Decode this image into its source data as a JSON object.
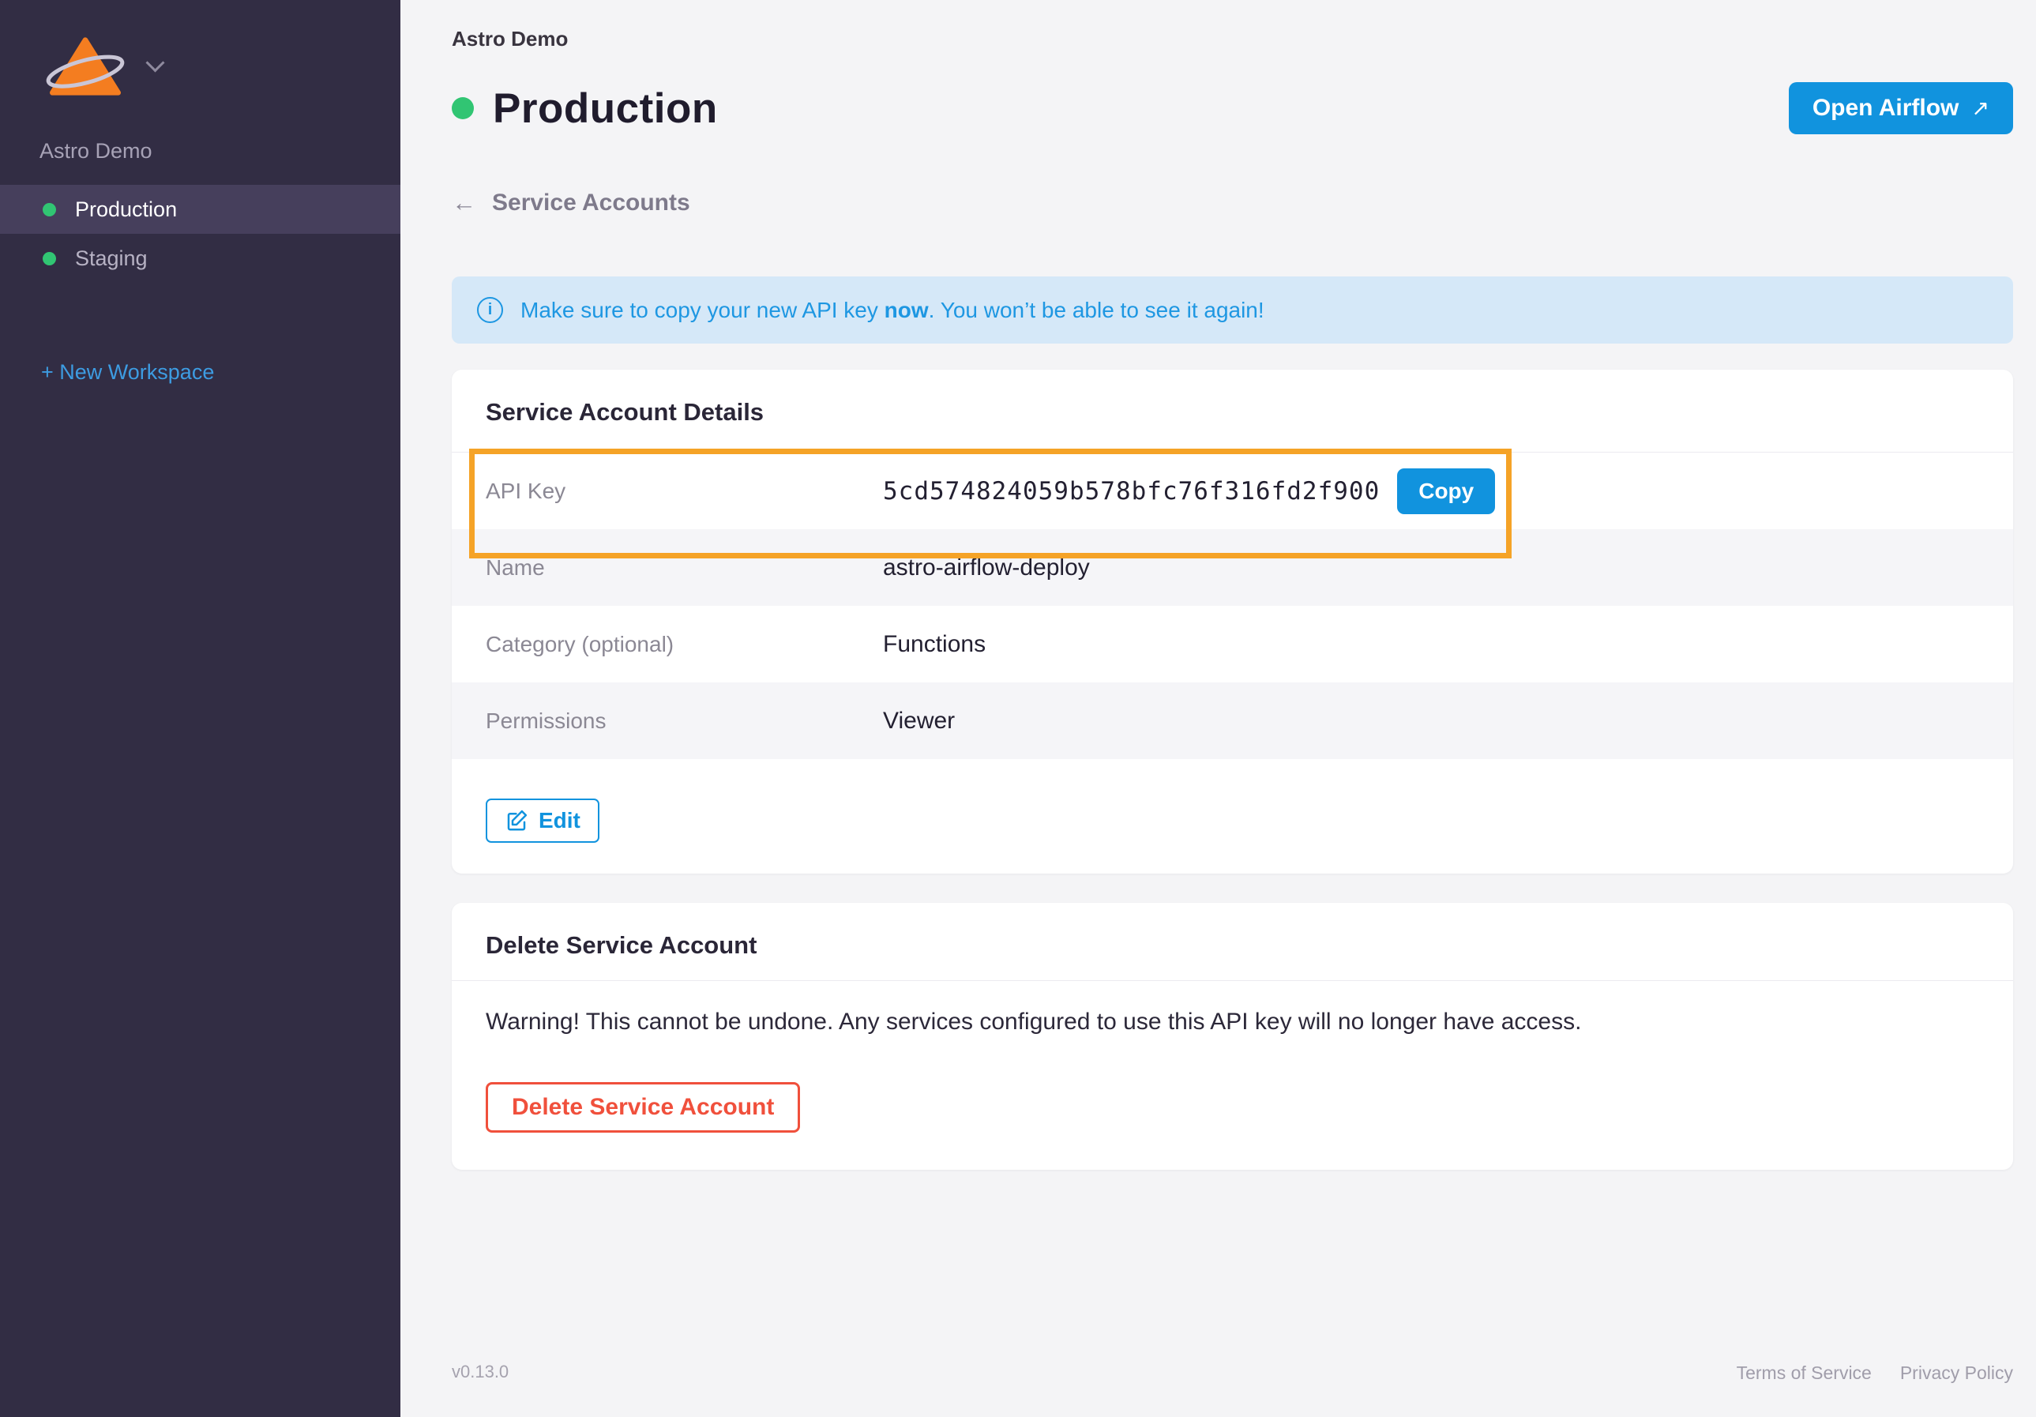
{
  "sidebar": {
    "workspace_name": "Astro Demo",
    "items": [
      {
        "label": "Production",
        "active": true
      },
      {
        "label": "Staging",
        "active": false
      }
    ],
    "new_workspace_label": "+ New Workspace"
  },
  "header": {
    "breadcrumb": "Astro Demo",
    "title": "Production",
    "open_airflow_label": "Open Airflow",
    "back_link": "Service Accounts"
  },
  "banner": {
    "text_before": "Make sure to copy your new API key ",
    "bold": "now",
    "text_after": ". You won’t be able to see it again!"
  },
  "details_card": {
    "title": "Service Account Details",
    "rows": [
      {
        "label": "API Key",
        "value": "5cd574824059b578bfc76f316fd2f900",
        "mono": true,
        "copy_label": "Copy"
      },
      {
        "label": "Name",
        "value": "astro-airflow-deploy"
      },
      {
        "label": "Category (optional)",
        "value": "Functions"
      },
      {
        "label": "Permissions",
        "value": "Viewer"
      }
    ],
    "edit_label": "Edit"
  },
  "delete_card": {
    "title": "Delete Service Account",
    "warning": "Warning! This cannot be undone. Any services configured to use this API key will no longer have access.",
    "button_label": "Delete Service Account"
  },
  "footer": {
    "version": "v0.13.0",
    "links": [
      "Terms of Service",
      "Privacy Policy"
    ]
  },
  "icons": {
    "open_airflow": "↗",
    "back_arrow": "←",
    "info": "i"
  },
  "colors": {
    "sidebar_bg": "#322d44",
    "accent_blue": "#1193de",
    "status_green": "#31c573",
    "annotation_orange": "#f5a327",
    "danger_red": "#f0503c",
    "banner_bg": "#d5e8f8"
  }
}
